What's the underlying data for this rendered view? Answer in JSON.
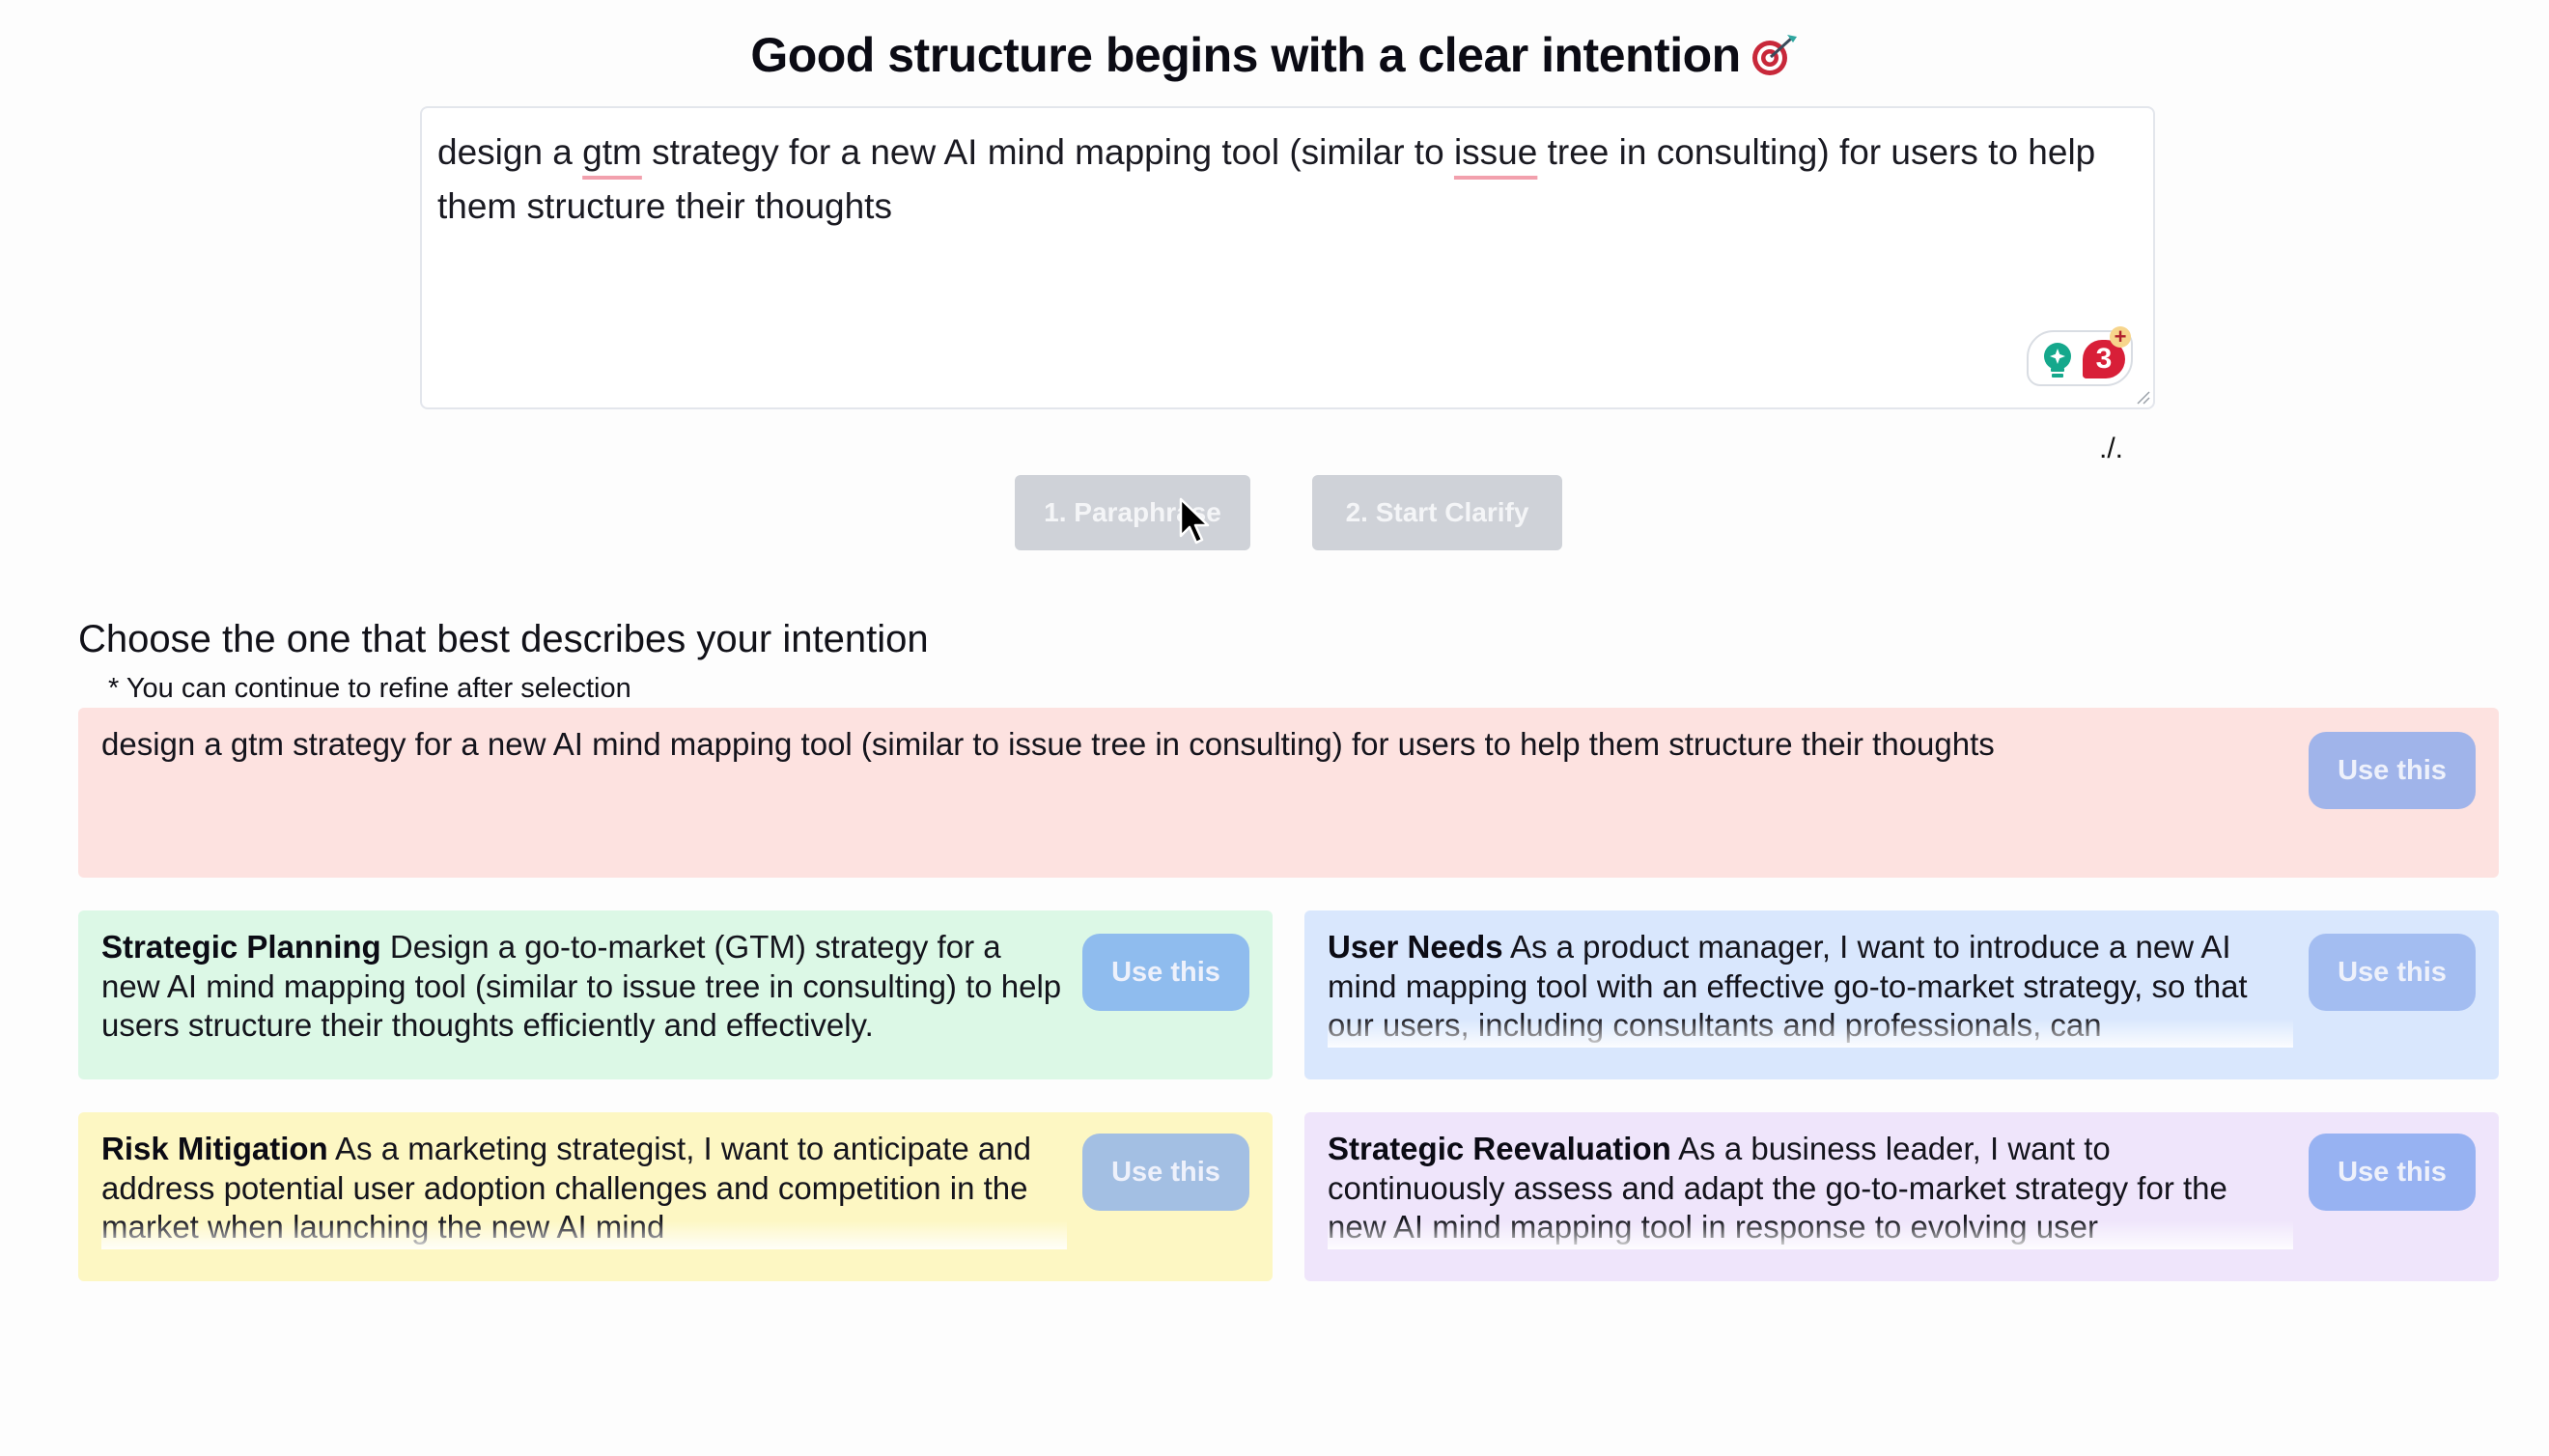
{
  "header": {
    "title": "Good structure begins with a clear intention",
    "title_icon": "target-dart-icon"
  },
  "input": {
    "segments": [
      {
        "text": "design a ",
        "spell": false
      },
      {
        "text": "gtm",
        "spell": true
      },
      {
        "text": " strategy for a new AI mind mapping tool (similar to ",
        "spell": false
      },
      {
        "text": "issue",
        "spell": true
      },
      {
        "text": " tree in consulting) for users to help them structure their thoughts",
        "spell": false
      }
    ],
    "widget": {
      "icon_left": "lightbulb-icon",
      "badge_count": "3",
      "badge_plus": "+"
    }
  },
  "slash_text": "./.",
  "actions": {
    "paraphrase_label": "1. Paraphrase",
    "clarify_label": "2. Start Clarify"
  },
  "section": {
    "heading": "Choose the one that best describes your intention",
    "note": "* You can continue to refine after selection"
  },
  "cards": [
    {
      "title": "",
      "body": "design a gtm strategy for a new AI mind mapping tool (similar to issue tree in consulting) for users to help them structure their thoughts",
      "button": "Use this",
      "bg": "#fde2e0",
      "button_color": "#a0b4ea"
    },
    {
      "title": "Strategic Planning",
      "body": "Design a go-to-market (GTM) strategy for a new AI mind mapping tool (similar to issue tree in consulting) to help users structure their thoughts efficiently and effectively.",
      "button": "Use this",
      "bg": "#dcf8e6",
      "button_color": "#8fbcee"
    },
    {
      "title": "User Needs",
      "body": "As a product manager, I want to introduce a new AI mind mapping tool with an effective go-to-market strategy, so that our users, including consultants and professionals, can",
      "button": "Use this",
      "bg": "#d9e7fd",
      "button_color": "#a3bdf1"
    },
    {
      "title": "Risk Mitigation",
      "body": "As a marketing strategist, I want to anticipate and address potential user adoption challenges and competition in the market when launching the new AI mind",
      "button": "Use this",
      "bg": "#fdf7c3",
      "button_color": "#a3bfe3"
    },
    {
      "title": "Strategic Reevaluation",
      "body": "As a business leader, I want to continuously assess and adapt the go-to-market strategy for the new AI mind mapping tool in response to evolving user",
      "button": "Use this",
      "bg": "#efe5fb",
      "button_color": "#97b2f2"
    }
  ]
}
